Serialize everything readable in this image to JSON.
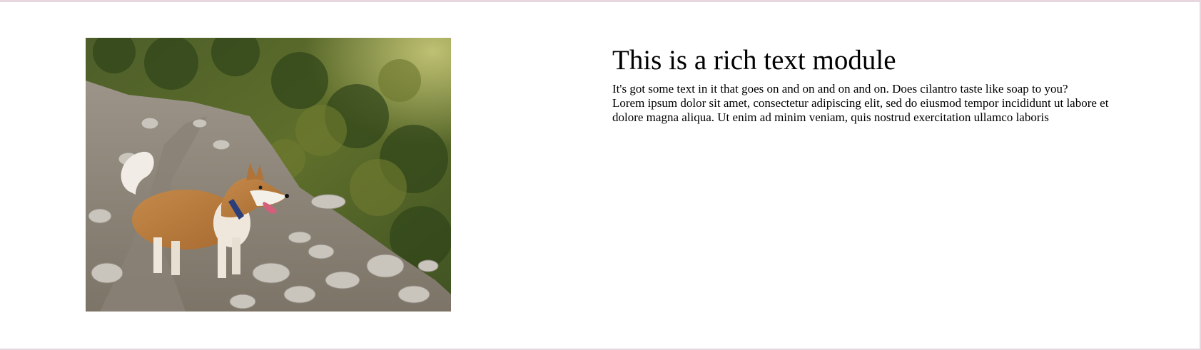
{
  "module": {
    "image": {
      "alt": "Dog on a rocky mountain trail",
      "icon": "photo-dog-trail"
    },
    "heading": "This is a rich text module",
    "paragraph_line_1": "It's got some text in it that goes on and on and on and on. Does cilantro taste like soap to you?",
    "paragraph_line_2": "Lorem ipsum dolor sit amet, consectetur adipiscing elit, sed do eiusmod tempor incididunt ut labore et dolore magna aliqua. Ut enim ad minim veniam, quis nostrud exercitation ullamco laboris"
  },
  "colors": {
    "page_border": "#e6d6dd",
    "text": "#000000",
    "background": "#ffffff"
  }
}
